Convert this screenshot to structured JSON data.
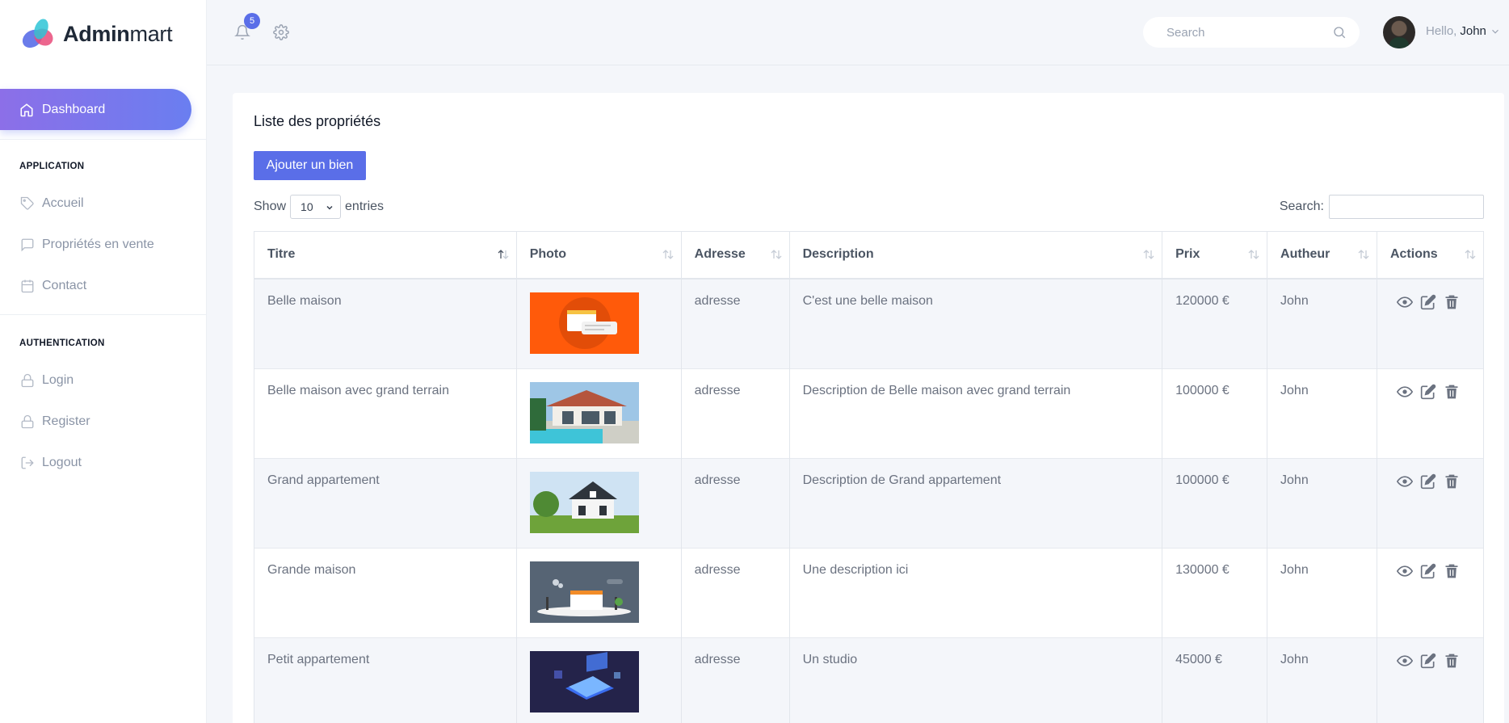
{
  "brand": {
    "bold": "Admin",
    "light": "mart"
  },
  "sidebar": {
    "active": {
      "label": "Dashboard",
      "icon": "home-icon"
    },
    "sections": [
      {
        "title": "APPLICATION",
        "items": [
          {
            "label": "Accueil",
            "icon": "tag-icon"
          },
          {
            "label": "Propriétés en vente",
            "icon": "message-icon"
          },
          {
            "label": "Contact",
            "icon": "calendar-icon"
          }
        ]
      },
      {
        "title": "AUTHENTICATION",
        "items": [
          {
            "label": "Login",
            "icon": "lock-icon"
          },
          {
            "label": "Register",
            "icon": "lock-icon"
          },
          {
            "label": "Logout",
            "icon": "logout-icon"
          }
        ]
      }
    ]
  },
  "topbar": {
    "notifications": "5",
    "search_placeholder": "Search",
    "greeting": "Hello,",
    "user": "John"
  },
  "page": {
    "title": "Liste des propriétés",
    "add_button": "Ajouter un bien",
    "show_label": "Show",
    "entries_value": "10",
    "entries_label": "entries",
    "search_label": "Search:"
  },
  "table": {
    "columns": [
      "Titre",
      "Photo",
      "Adresse",
      "Description",
      "Prix",
      "Autheur",
      "Actions"
    ],
    "rows": [
      {
        "titre": "Belle maison",
        "photo": "illustration-orange",
        "adresse": "adresse",
        "description": "C'est une belle maison",
        "prix": "120000 €",
        "auteur": "John"
      },
      {
        "titre": "Belle maison avec grand terrain",
        "photo": "house-pool",
        "adresse": "adresse",
        "description": "Description de Belle maison avec grand terrain",
        "prix": "100000 €",
        "auteur": "John"
      },
      {
        "titre": "Grand appartement",
        "photo": "house-lawn",
        "adresse": "adresse",
        "description": "Description de Grand appartement",
        "prix": "100000 €",
        "auteur": "John"
      },
      {
        "titre": "Grande maison",
        "photo": "illustration-gray",
        "adresse": "adresse",
        "description": "Une description ici",
        "prix": "130000 €",
        "auteur": "John"
      },
      {
        "titre": "Petit appartement",
        "photo": "illustration-dark",
        "adresse": "adresse",
        "description": "Un studio",
        "prix": "45000 €",
        "auteur": "John"
      }
    ]
  },
  "colors": {
    "accent": "#5a6ee8",
    "gradient_start": "#8c6fe8",
    "gradient_end": "#6a7ef0"
  }
}
